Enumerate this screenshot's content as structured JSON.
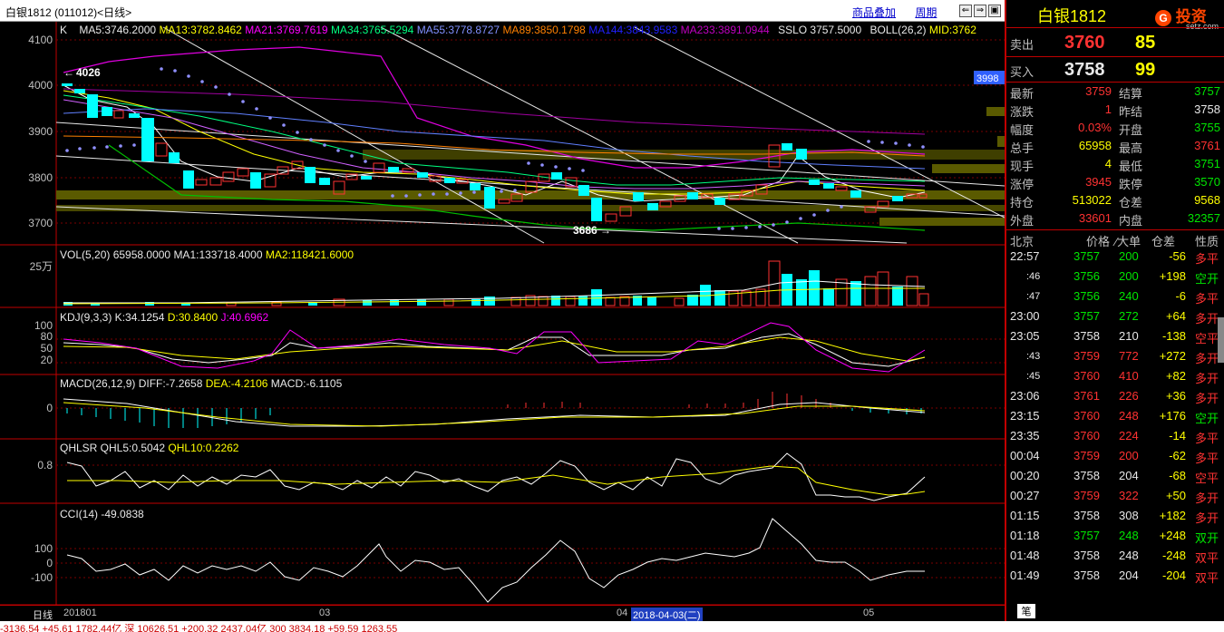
{
  "window": {
    "title": "白银1812 (011012)<日线>",
    "link_overlay": "商品叠加",
    "link_period": "周期"
  },
  "chart_panels": {
    "main_label": "K",
    "ma5": "MA5:3746.2000",
    "ma13": "MA13:3782.8462",
    "ma21": "MA21:3769.7619",
    "ma34": "MA34:3765.5294",
    "ma55": "MA55:3778.8727",
    "ma89": "MA89:3850.1798",
    "ma144": "MA144:3843.9583",
    "ma233": "MA233:3891.0944",
    "sslo": "SSLO  3757.5000",
    "boll": "BOLL(26,2)",
    "mid": "MID:3762",
    "price_axis": [
      "4100",
      "4000",
      "3900",
      "3800",
      "3700"
    ],
    "marker_high": "4026",
    "marker_low": "3686",
    "price_tag": "3998",
    "vol_label": "VOL(5,20)  65958.0000",
    "vol_ma1": "MA1:133718.4000",
    "vol_ma2": "MA2:118421.6000",
    "vol_axis": "25万",
    "kdj_label": "KDJ(9,3,3)  K:34.1254",
    "kdj_d": "D:30.8400",
    "kdj_j": "J:40.6962",
    "kdj_axis": [
      "100",
      "80",
      "50",
      "20"
    ],
    "macd_label": "MACD(26,12,9)  DIFF:-7.2658",
    "macd_dea": "DEA:-4.2106",
    "macd_val": "MACD:-6.1105",
    "macd_axis": "0",
    "qhlsr_label": "QHLSR  QHL5:0.5042",
    "qhlsr_ql10": "QHL10:0.2262",
    "qhlsr_axis": "0.8",
    "cci_label": "CCI(14)  -49.0838",
    "cci_axis": [
      "100",
      "0",
      "-100"
    ],
    "x_axis": [
      "201801",
      "03",
      "04",
      "05"
    ],
    "period_tab": "日线",
    "cursor_date": "2018-04-03(二)"
  },
  "quote": {
    "title": "白银1812",
    "logo": "投资",
    "logo_sub": "setz.com",
    "sell_label": "卖出",
    "sell_price": "3760",
    "sell_vol": "85",
    "buy_label": "买入",
    "buy_price": "3758",
    "buy_vol": "99",
    "rows": [
      {
        "k1": "最新",
        "v1": "3759",
        "c1": "red",
        "k2": "结算",
        "v2": "3757",
        "c2": "grn"
      },
      {
        "k1": "涨跌",
        "v1": "1",
        "c1": "red",
        "k2": "昨结",
        "v2": "3758",
        "c2": "wht"
      },
      {
        "k1": "幅度",
        "v1": "0.03%",
        "c1": "red",
        "k2": "开盘",
        "v2": "3755",
        "c2": "grn"
      },
      {
        "k1": "总手",
        "v1": "65958",
        "c1": "yel",
        "k2": "最高",
        "v2": "3761",
        "c2": "red"
      },
      {
        "k1": "现手",
        "v1": "4",
        "c1": "yel",
        "k2": "最低",
        "v2": "3751",
        "c2": "grn"
      },
      {
        "k1": "涨停",
        "v1": "3945",
        "c1": "red",
        "k2": "跌停",
        "v2": "3570",
        "c2": "grn"
      },
      {
        "k1": "持仓",
        "v1": "513022",
        "c1": "yel",
        "k2": "仓差",
        "v2": "9568",
        "c2": "yel"
      },
      {
        "k1": "外盘",
        "v1": "33601",
        "c1": "red",
        "k2": "内盘",
        "v2": "32357",
        "c2": "grn"
      }
    ],
    "tick_header": {
      "time": "北京",
      "price": "价格",
      "vol": "⁄大单",
      "diff": "仓差",
      "nature": "性质"
    },
    "ticks": [
      {
        "t": "22:57",
        "p": "3757",
        "pc": "grn",
        "v": "200",
        "d": "-56",
        "dc": "yel",
        "n": "多平",
        "nc": "red"
      },
      {
        "t": ":46",
        "p": "3756",
        "pc": "grn",
        "v": "200",
        "d": "+198",
        "dc": "yel",
        "n": "空开",
        "nc": "grn"
      },
      {
        "t": ":47",
        "p": "3756",
        "pc": "grn",
        "v": "240",
        "d": "-6",
        "dc": "yel",
        "n": "多平",
        "nc": "red"
      },
      {
        "t": "23:00",
        "p": "3757",
        "pc": "grn",
        "v": "272",
        "d": "+64",
        "dc": "yel",
        "n": "多开",
        "nc": "red"
      },
      {
        "t": "23:05",
        "p": "3758",
        "pc": "wht",
        "v": "210",
        "d": "-138",
        "dc": "yel",
        "n": "空平",
        "nc": "red"
      },
      {
        "t": ":43",
        "p": "3759",
        "pc": "red",
        "v": "772",
        "d": "+272",
        "dc": "yel",
        "n": "多开",
        "nc": "red"
      },
      {
        "t": ":45",
        "p": "3760",
        "pc": "red",
        "v": "410",
        "d": "+82",
        "dc": "yel",
        "n": "多开",
        "nc": "red"
      },
      {
        "t": "23:06",
        "p": "3761",
        "pc": "red",
        "v": "226",
        "d": "+36",
        "dc": "yel",
        "n": "多开",
        "nc": "red"
      },
      {
        "t": "23:15",
        "p": "3760",
        "pc": "red",
        "v": "248",
        "d": "+176",
        "dc": "yel",
        "n": "空开",
        "nc": "grn"
      },
      {
        "t": "23:35",
        "p": "3760",
        "pc": "red",
        "v": "224",
        "d": "-14",
        "dc": "yel",
        "n": "多平",
        "nc": "red"
      },
      {
        "t": "00:04",
        "p": "3759",
        "pc": "red",
        "v": "200",
        "d": "-62",
        "dc": "yel",
        "n": "多平",
        "nc": "red"
      },
      {
        "t": "00:20",
        "p": "3758",
        "pc": "wht",
        "v": "204",
        "d": "-68",
        "dc": "yel",
        "n": "空平",
        "nc": "red"
      },
      {
        "t": "00:27",
        "p": "3759",
        "pc": "red",
        "v": "322",
        "d": "+50",
        "dc": "yel",
        "n": "多开",
        "nc": "red"
      },
      {
        "t": "01:15",
        "p": "3758",
        "pc": "wht",
        "v": "308",
        "d": "+182",
        "dc": "yel",
        "n": "多开",
        "nc": "red"
      },
      {
        "t": "01:18",
        "p": "3757",
        "pc": "grn",
        "v": "248",
        "d": "+248",
        "dc": "yel",
        "n": "双开",
        "nc": "grn"
      },
      {
        "t": "01:48",
        "p": "3758",
        "pc": "wht",
        "v": "248",
        "d": "-248",
        "dc": "yel",
        "n": "双平",
        "nc": "red"
      },
      {
        "t": "01:49",
        "p": "3758",
        "pc": "wht",
        "v": "204",
        "d": "-204",
        "dc": "yel",
        "n": "双平",
        "nc": "red"
      }
    ],
    "bottom_tab": "笔"
  },
  "status_line": "-3136.54   +45.61  1782.44亿   深  10626.51  +200.32  2437.04亿   300  3834.18   +59.59  1263.55"
}
